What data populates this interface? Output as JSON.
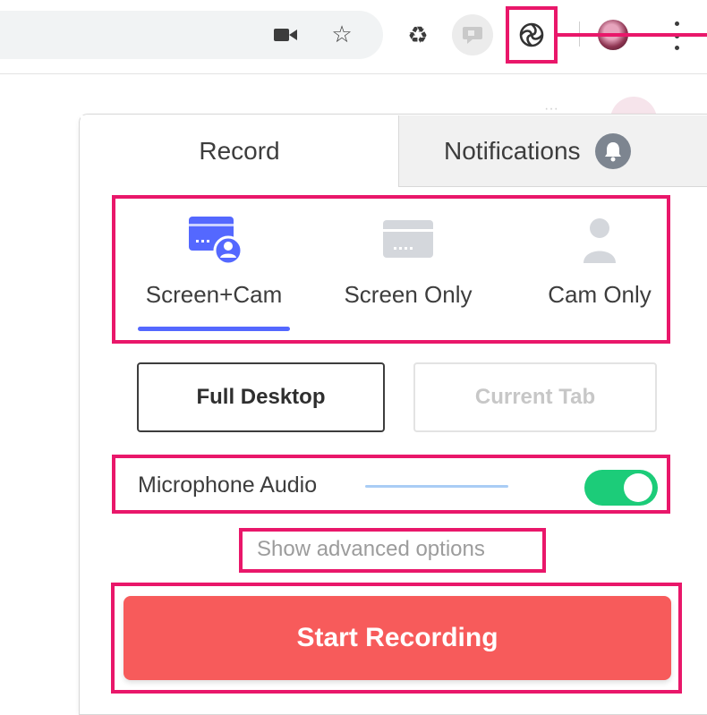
{
  "tabs": {
    "record_label": "Record",
    "notifications_label": "Notifications"
  },
  "modes": [
    {
      "label": "Screen+Cam",
      "icon": "screen-cam-icon",
      "selected": true
    },
    {
      "label": "Screen Only",
      "icon": "screen-icon",
      "selected": false
    },
    {
      "label": "Cam Only",
      "icon": "person-icon",
      "selected": false
    }
  ],
  "capture": {
    "full_desktop_label": "Full Desktop",
    "current_tab_label": "Current Tab"
  },
  "microphone": {
    "label": "Microphone Audio",
    "enabled": true
  },
  "advanced_link": "Show advanced options",
  "start_button": "Start Recording",
  "colors": {
    "accent_blue": "#5468ff",
    "toggle_on": "#1ccc79",
    "start_red": "#f75b5b",
    "annotation_pink": "#e9176a"
  }
}
